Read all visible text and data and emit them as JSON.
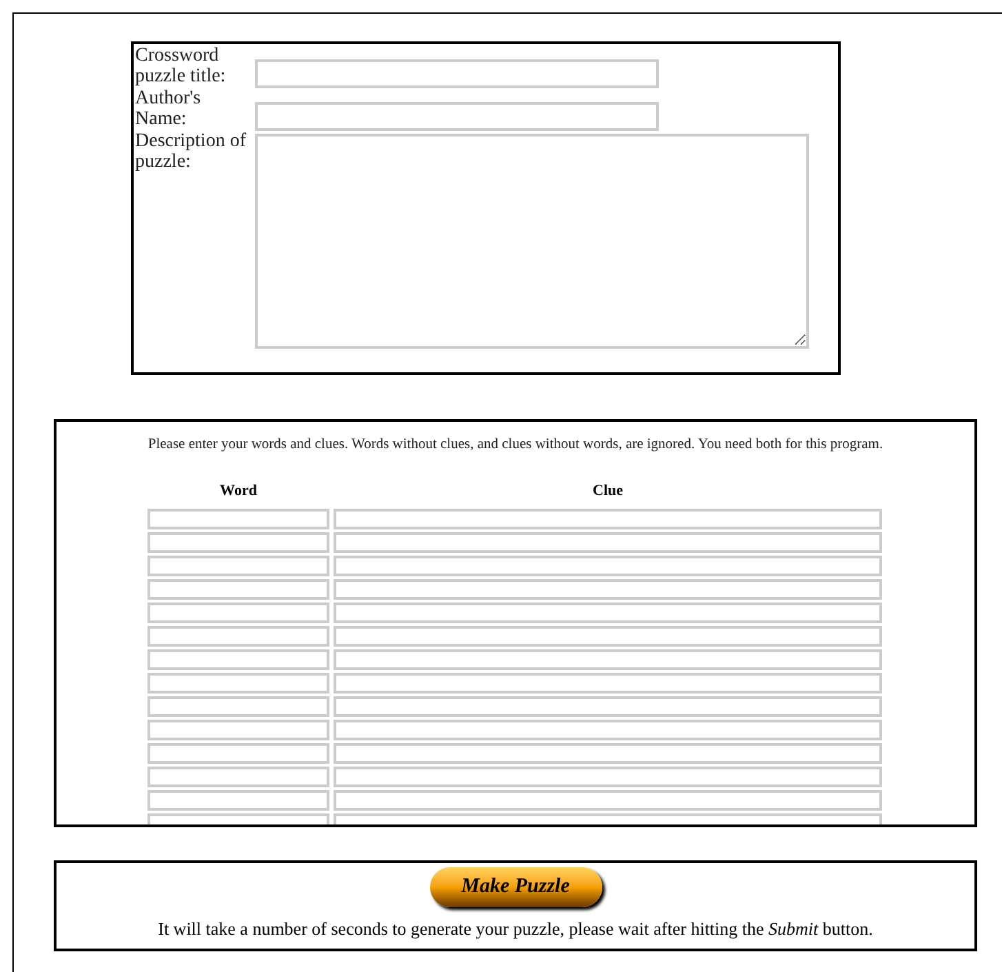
{
  "puzzle_info": {
    "fields": [
      {
        "label": "Crossword puzzle title:",
        "kind": "text"
      },
      {
        "label": "Author's Name:",
        "kind": "text"
      },
      {
        "label": "Description of puzzle:",
        "kind": "textarea"
      }
    ]
  },
  "words_and_clues": {
    "instructions": "Please enter your words and clues. Words without clues, and clues without words, are ignored. You need both for this program.",
    "columns": [
      "Word",
      "Clue"
    ]
  },
  "submit": {
    "button": "Make Puzzle",
    "note": "It will take a number of seconds to generate your puzzle, please wait after hitting the *Submit* button."
  }
}
